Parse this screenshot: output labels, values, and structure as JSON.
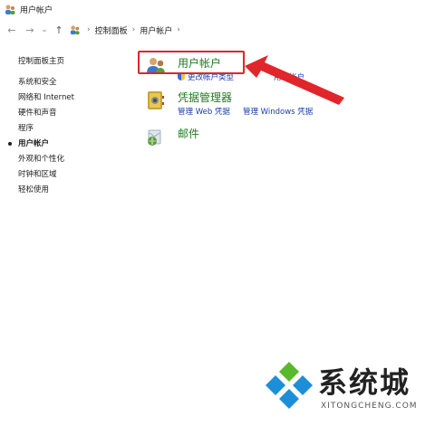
{
  "window": {
    "title": "用户帐户",
    "icon": "user-accounts-icon"
  },
  "nav": {
    "back": "←",
    "forward": "→",
    "dropdown": "⌄",
    "up": "↑",
    "breadcrumb": [
      "控制面板",
      "用户帐户"
    ],
    "sep": "›"
  },
  "sidebar": {
    "home": "控制面板主页",
    "items": [
      {
        "label": "系统和安全",
        "active": false
      },
      {
        "label": "网络和 Internet",
        "active": false
      },
      {
        "label": "硬件和声音",
        "active": false
      },
      {
        "label": "程序",
        "active": false
      },
      {
        "label": "用户帐户",
        "active": true
      },
      {
        "label": "外观和个性化",
        "active": false
      },
      {
        "label": "时钟和区域",
        "active": false
      },
      {
        "label": "轻松使用",
        "active": false
      }
    ]
  },
  "main": {
    "categories": [
      {
        "title": "用户帐户",
        "icon": "users-icon",
        "links": [
          "更改帐户类型",
          "用户帐户"
        ]
      },
      {
        "title": "凭据管理器",
        "icon": "credential-vault-icon",
        "links": [
          "管理 Web 凭据",
          "管理 Windows 凭据"
        ]
      },
      {
        "title": "邮件",
        "icon": "mail-icon",
        "links": []
      }
    ]
  },
  "annotation": {
    "color": "#e0262a"
  },
  "watermark": {
    "text": "系统城",
    "sub": "XITONGCHENG.COM"
  },
  "colors": {
    "category_title": "#1e7a1e",
    "link": "#1a3ea8",
    "logo_green": "#59b82b",
    "logo_blue": "#1d8fd8"
  }
}
